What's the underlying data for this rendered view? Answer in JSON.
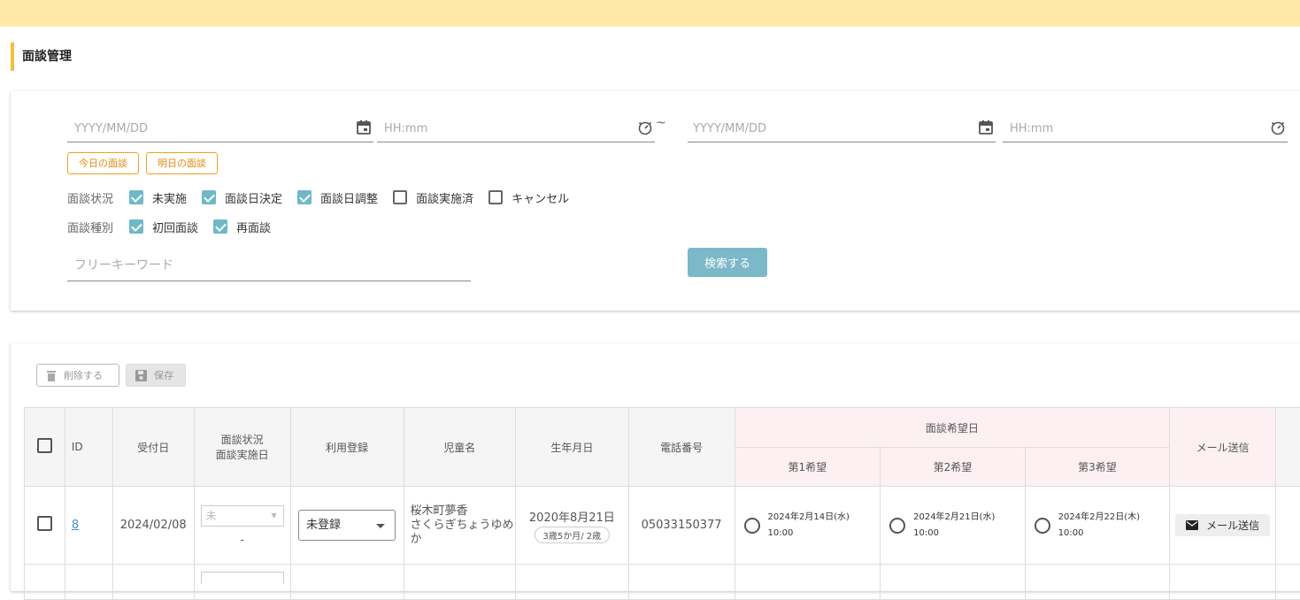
{
  "page": {
    "title": "面談管理"
  },
  "search": {
    "date_placeholder": "YYYY/MM/DD",
    "time_placeholder": "HH:mm",
    "range_separator": "~",
    "today_label": "今日の面談",
    "tomorrow_label": "明日の面談",
    "status_label": "面談状況",
    "status_options": [
      {
        "label": "未実施",
        "checked": true
      },
      {
        "label": "面談日決定",
        "checked": true
      },
      {
        "label": "面談日調整",
        "checked": true
      },
      {
        "label": "面談実施済",
        "checked": false
      },
      {
        "label": "キャンセル",
        "checked": false
      }
    ],
    "type_label": "面談種別",
    "type_options": [
      {
        "label": "初回面談",
        "checked": true
      },
      {
        "label": "再面談",
        "checked": true
      }
    ],
    "keyword_placeholder": "フリーキーワード",
    "search_button": "検索する"
  },
  "toolbar": {
    "delete_label": "削除する",
    "save_label": "保存"
  },
  "table": {
    "headers": {
      "id": "ID",
      "received": "受付日",
      "status_line1": "面談状況",
      "status_line2": "面談実施日",
      "registration": "利用登録",
      "child_name": "児童名",
      "birthdate": "生年月日",
      "phone": "電話番号",
      "preferred": "面談希望日",
      "pref1": "第1希望",
      "pref2": "第2希望",
      "pref3": "第3希望",
      "mail": "メール送信"
    },
    "rows": [
      {
        "id": "8",
        "received": "2024/02/08",
        "status_value": "未",
        "status_date": "-",
        "registration": "未登録",
        "child_name": "桜木町夢香",
        "child_kana": "さくらぎちょうゆめか",
        "birthdate": "2020年8月21日",
        "age": "3歳5か月/ 2歳",
        "phone": "05033150377",
        "pref1_date": "2024年2月14日(水)",
        "pref1_time": "10:00",
        "pref2_date": "2024年2月21日(水)",
        "pref2_time": "10:00",
        "pref3_date": "2024年2月22日(木)",
        "pref3_time": "10:00",
        "mail_button": "メール送信"
      }
    ]
  }
}
